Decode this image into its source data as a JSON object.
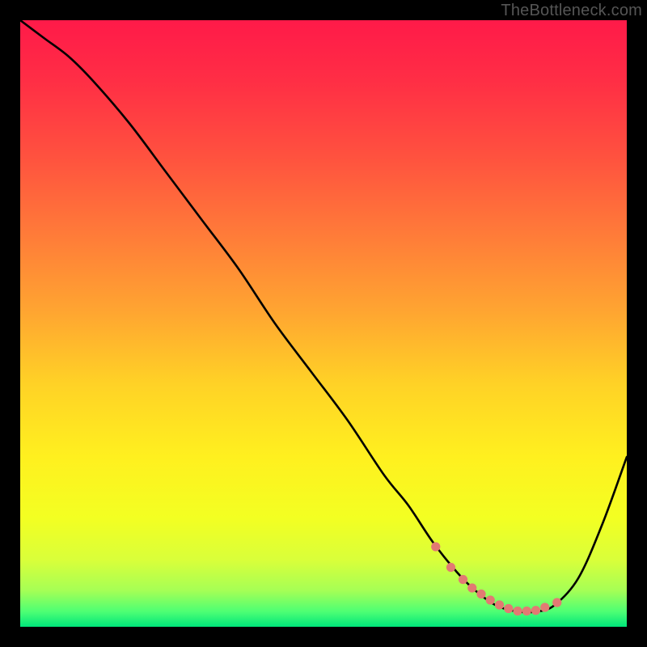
{
  "watermark": "TheBottleneck.com",
  "colors": {
    "frame": "#000000",
    "curve_stroke": "#000000",
    "marker_fill": "#e27a73",
    "gradient_stops": [
      {
        "offset": 0.0,
        "color": "#ff1a49"
      },
      {
        "offset": 0.1,
        "color": "#ff2e45"
      },
      {
        "offset": 0.22,
        "color": "#ff503f"
      },
      {
        "offset": 0.35,
        "color": "#ff7a39"
      },
      {
        "offset": 0.48,
        "color": "#ffa531"
      },
      {
        "offset": 0.6,
        "color": "#ffd226"
      },
      {
        "offset": 0.72,
        "color": "#fff01f"
      },
      {
        "offset": 0.82,
        "color": "#f3ff22"
      },
      {
        "offset": 0.89,
        "color": "#d9ff3a"
      },
      {
        "offset": 0.94,
        "color": "#a6ff55"
      },
      {
        "offset": 0.975,
        "color": "#4dff74"
      },
      {
        "offset": 1.0,
        "color": "#00e67a"
      }
    ]
  },
  "chart_data": {
    "type": "line",
    "title": "",
    "xlabel": "",
    "ylabel": "",
    "xlim": [
      0,
      100
    ],
    "ylim": [
      0,
      100
    ],
    "grid": false,
    "series": [
      {
        "name": "bottleneck-curve",
        "x": [
          0,
          4,
          8,
          12,
          18,
          24,
          30,
          36,
          42,
          48,
          54,
          60,
          64,
          68,
          72,
          75,
          78.5,
          82,
          85,
          88,
          92,
          96,
          100
        ],
        "y": [
          100,
          97,
          94,
          90,
          83,
          75,
          67,
          59,
          50,
          42,
          34,
          25,
          20,
          14,
          9,
          6,
          3.5,
          2.5,
          2.5,
          3.5,
          8,
          17,
          28
        ]
      }
    ],
    "markers": {
      "name": "valley-markers",
      "x": [
        68.5,
        71,
        73,
        74.5,
        76,
        77.5,
        79,
        80.5,
        82,
        83.5,
        85,
        86.5,
        88.5
      ],
      "y": [
        13.2,
        9.8,
        7.8,
        6.4,
        5.4,
        4.4,
        3.6,
        3.0,
        2.6,
        2.6,
        2.7,
        3.2,
        4.0
      ]
    }
  }
}
